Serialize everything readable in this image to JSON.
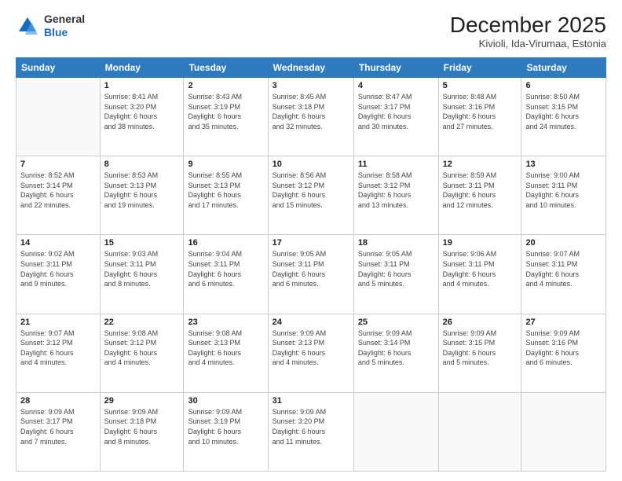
{
  "logo": {
    "general": "General",
    "blue": "Blue"
  },
  "title": "December 2025",
  "subtitle": "Kivioli, Ida-Virumaa, Estonia",
  "days_of_week": [
    "Sunday",
    "Monday",
    "Tuesday",
    "Wednesday",
    "Thursday",
    "Friday",
    "Saturday"
  ],
  "weeks": [
    [
      {
        "day": "",
        "info": ""
      },
      {
        "day": "1",
        "info": "Sunrise: 8:41 AM\nSunset: 3:20 PM\nDaylight: 6 hours\nand 38 minutes."
      },
      {
        "day": "2",
        "info": "Sunrise: 8:43 AM\nSunset: 3:19 PM\nDaylight: 6 hours\nand 35 minutes."
      },
      {
        "day": "3",
        "info": "Sunrise: 8:45 AM\nSunset: 3:18 PM\nDaylight: 6 hours\nand 32 minutes."
      },
      {
        "day": "4",
        "info": "Sunrise: 8:47 AM\nSunset: 3:17 PM\nDaylight: 6 hours\nand 30 minutes."
      },
      {
        "day": "5",
        "info": "Sunrise: 8:48 AM\nSunset: 3:16 PM\nDaylight: 6 hours\nand 27 minutes."
      },
      {
        "day": "6",
        "info": "Sunrise: 8:50 AM\nSunset: 3:15 PM\nDaylight: 6 hours\nand 24 minutes."
      }
    ],
    [
      {
        "day": "7",
        "info": "Sunrise: 8:52 AM\nSunset: 3:14 PM\nDaylight: 6 hours\nand 22 minutes."
      },
      {
        "day": "8",
        "info": "Sunrise: 8:53 AM\nSunset: 3:13 PM\nDaylight: 6 hours\nand 19 minutes."
      },
      {
        "day": "9",
        "info": "Sunrise: 8:55 AM\nSunset: 3:13 PM\nDaylight: 6 hours\nand 17 minutes."
      },
      {
        "day": "10",
        "info": "Sunrise: 8:56 AM\nSunset: 3:12 PM\nDaylight: 6 hours\nand 15 minutes."
      },
      {
        "day": "11",
        "info": "Sunrise: 8:58 AM\nSunset: 3:12 PM\nDaylight: 6 hours\nand 13 minutes."
      },
      {
        "day": "12",
        "info": "Sunrise: 8:59 AM\nSunset: 3:11 PM\nDaylight: 6 hours\nand 12 minutes."
      },
      {
        "day": "13",
        "info": "Sunrise: 9:00 AM\nSunset: 3:11 PM\nDaylight: 6 hours\nand 10 minutes."
      }
    ],
    [
      {
        "day": "14",
        "info": "Sunrise: 9:02 AM\nSunset: 3:11 PM\nDaylight: 6 hours\nand 9 minutes."
      },
      {
        "day": "15",
        "info": "Sunrise: 9:03 AM\nSunset: 3:11 PM\nDaylight: 6 hours\nand 8 minutes."
      },
      {
        "day": "16",
        "info": "Sunrise: 9:04 AM\nSunset: 3:11 PM\nDaylight: 6 hours\nand 6 minutes."
      },
      {
        "day": "17",
        "info": "Sunrise: 9:05 AM\nSunset: 3:11 PM\nDaylight: 6 hours\nand 6 minutes."
      },
      {
        "day": "18",
        "info": "Sunrise: 9:05 AM\nSunset: 3:11 PM\nDaylight: 6 hours\nand 5 minutes."
      },
      {
        "day": "19",
        "info": "Sunrise: 9:06 AM\nSunset: 3:11 PM\nDaylight: 6 hours\nand 4 minutes."
      },
      {
        "day": "20",
        "info": "Sunrise: 9:07 AM\nSunset: 3:11 PM\nDaylight: 6 hours\nand 4 minutes."
      }
    ],
    [
      {
        "day": "21",
        "info": "Sunrise: 9:07 AM\nSunset: 3:12 PM\nDaylight: 6 hours\nand 4 minutes."
      },
      {
        "day": "22",
        "info": "Sunrise: 9:08 AM\nSunset: 3:12 PM\nDaylight: 6 hours\nand 4 minutes."
      },
      {
        "day": "23",
        "info": "Sunrise: 9:08 AM\nSunset: 3:13 PM\nDaylight: 6 hours\nand 4 minutes."
      },
      {
        "day": "24",
        "info": "Sunrise: 9:09 AM\nSunset: 3:13 PM\nDaylight: 6 hours\nand 4 minutes."
      },
      {
        "day": "25",
        "info": "Sunrise: 9:09 AM\nSunset: 3:14 PM\nDaylight: 6 hours\nand 5 minutes."
      },
      {
        "day": "26",
        "info": "Sunrise: 9:09 AM\nSunset: 3:15 PM\nDaylight: 6 hours\nand 5 minutes."
      },
      {
        "day": "27",
        "info": "Sunrise: 9:09 AM\nSunset: 3:16 PM\nDaylight: 6 hours\nand 6 minutes."
      }
    ],
    [
      {
        "day": "28",
        "info": "Sunrise: 9:09 AM\nSunset: 3:17 PM\nDaylight: 6 hours\nand 7 minutes."
      },
      {
        "day": "29",
        "info": "Sunrise: 9:09 AM\nSunset: 3:18 PM\nDaylight: 6 hours\nand 8 minutes."
      },
      {
        "day": "30",
        "info": "Sunrise: 9:09 AM\nSunset: 3:19 PM\nDaylight: 6 hours\nand 10 minutes."
      },
      {
        "day": "31",
        "info": "Sunrise: 9:09 AM\nSunset: 3:20 PM\nDaylight: 6 hours\nand 11 minutes."
      },
      {
        "day": "",
        "info": ""
      },
      {
        "day": "",
        "info": ""
      },
      {
        "day": "",
        "info": ""
      }
    ]
  ]
}
